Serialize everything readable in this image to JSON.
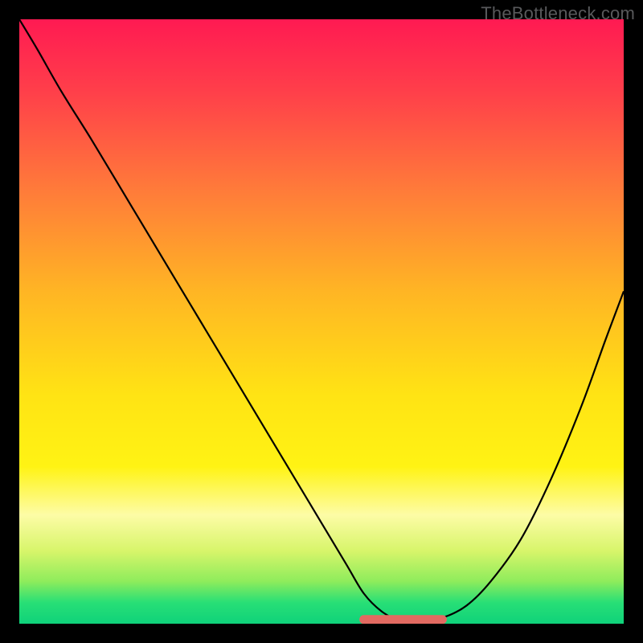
{
  "watermark": "TheBottleneck.com",
  "chart_data": {
    "type": "line",
    "title": "",
    "xlabel": "",
    "ylabel": "",
    "xlim": [
      0,
      100
    ],
    "ylim": [
      0,
      100
    ],
    "grid": false,
    "background_gradient": {
      "stops": [
        {
          "offset": 0.0,
          "color": "#ff1a52"
        },
        {
          "offset": 0.12,
          "color": "#ff3f4a"
        },
        {
          "offset": 0.28,
          "color": "#ff7a3a"
        },
        {
          "offset": 0.45,
          "color": "#ffb524"
        },
        {
          "offset": 0.62,
          "color": "#ffe314"
        },
        {
          "offset": 0.74,
          "color": "#fff314"
        },
        {
          "offset": 0.82,
          "color": "#fdfca6"
        },
        {
          "offset": 0.88,
          "color": "#d7f56a"
        },
        {
          "offset": 0.93,
          "color": "#8eec5c"
        },
        {
          "offset": 0.965,
          "color": "#28df76"
        },
        {
          "offset": 1.0,
          "color": "#0fd27a"
        }
      ]
    },
    "series": [
      {
        "name": "bottleneck-curve",
        "color": "#000000",
        "x": [
          0,
          3,
          7,
          12,
          18,
          24,
          30,
          36,
          42,
          48,
          54,
          57,
          60,
          63,
          66,
          70,
          74,
          78,
          83,
          88,
          93,
          97,
          100
        ],
        "y": [
          100,
          95,
          88,
          80,
          70,
          60,
          50,
          40,
          30,
          20,
          10,
          5,
          2,
          0.5,
          0.5,
          1,
          3,
          7,
          14,
          24,
          36,
          47,
          55
        ]
      }
    ],
    "highlight_segment": {
      "name": "optimal-range",
      "color": "#e26a61",
      "x_start": 57,
      "x_end": 70,
      "y": 0.7
    }
  }
}
